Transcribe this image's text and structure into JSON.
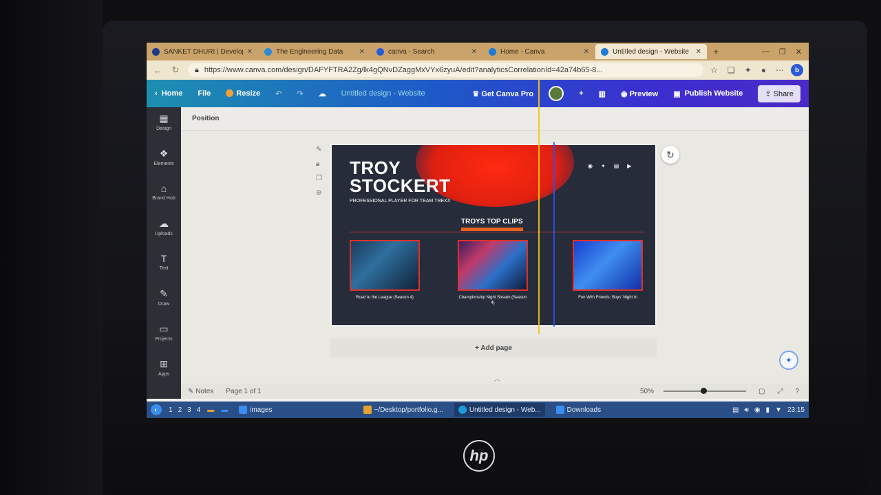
{
  "browser": {
    "tabs": [
      {
        "title": "SANKET DHURI | Develop",
        "icon": "globe-icon",
        "color": "#1a3a8a",
        "active": false
      },
      {
        "title": "The Engineering Data",
        "icon": "telegram-icon",
        "color": "#2a8ad4",
        "active": false
      },
      {
        "title": "canva - Search",
        "icon": "search-icon",
        "color": "#2a5bd7",
        "active": false
      },
      {
        "title": "Home - Canva",
        "icon": "canva-icon",
        "color": "#1e7ad8",
        "active": false
      },
      {
        "title": "Untitled design - Website",
        "icon": "canva-icon",
        "color": "#1e7ad8",
        "active": true
      }
    ],
    "url": "https://www.canva.com/design/DAFYFTRA2Zg/lk4gQNvDZaggMxVYx6zyuA/edit?analyticsCorrelationId=42a74b65-8..."
  },
  "canva": {
    "home": "Home",
    "file": "File",
    "resize": "Resize",
    "doc_title": "Untitled design - Website",
    "get_pro": "Get Canva Pro",
    "preview": "Preview",
    "publish": "Publish Website",
    "share": "Share",
    "position": "Position",
    "add_page": "+ Add page",
    "notes": "Notes",
    "page_info": "Page 1 of 1",
    "zoom": "50%"
  },
  "sidebar": [
    {
      "label": "Design",
      "icon": "design-icon"
    },
    {
      "label": "Elements",
      "icon": "elements-icon"
    },
    {
      "label": "Brand Hub",
      "icon": "brand-icon"
    },
    {
      "label": "Uploads",
      "icon": "upload-icon"
    },
    {
      "label": "Text",
      "icon": "text-icon"
    },
    {
      "label": "Draw",
      "icon": "draw-icon"
    },
    {
      "label": "Projects",
      "icon": "folder-icon"
    },
    {
      "label": "Apps",
      "icon": "apps-icon"
    }
  ],
  "design": {
    "name_line1": "TROY",
    "name_line2": "STOCKERT",
    "tagline": "PROFESSIONAL PLAYER FOR TEAM TREXX",
    "clips_title": "TROYS TOP CLIPS",
    "clips": [
      {
        "caption": "Road to the League (Season 4)"
      },
      {
        "caption": "Championship Night Stream (Season 4)"
      },
      {
        "caption": "Fun With Friends: Boys' Night In"
      }
    ]
  },
  "taskbar": {
    "workspaces": [
      "1",
      "2",
      "3",
      "4"
    ],
    "tasks": [
      {
        "label": "images",
        "color": "#3a8ef0",
        "active": false
      },
      {
        "label": "~/Desktop/portfolio.g...",
        "color": "#e8a030",
        "active": false
      },
      {
        "label": "Untitled design - Web...",
        "color": "#1e9ad8",
        "active": true
      },
      {
        "label": "Downloads",
        "color": "#3a8ef0",
        "active": false
      }
    ],
    "time": "23:15"
  },
  "device": {
    "brand": "hp"
  }
}
